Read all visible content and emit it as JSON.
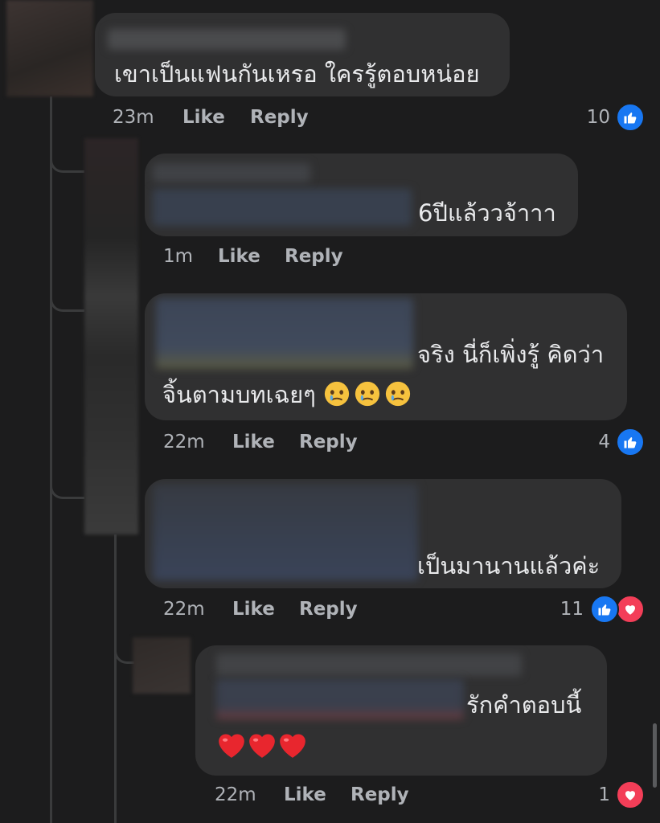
{
  "colors": {
    "background": "#1c1c1d",
    "bubble": "#303031",
    "like_blue": "#1877f2",
    "love_red": "#f33e58",
    "meta_text": "#b0b3b8"
  },
  "comments": [
    {
      "text_lines": [
        "เขาเป็นแฟนกันเหรอ ใครรู้ตอบหน่อย"
      ],
      "time": "23m",
      "like_label": "Like",
      "reply_label": "Reply",
      "reaction_count": "10",
      "reactions": [
        "like-icon"
      ]
    },
    {
      "text_lines": [
        "6ปีแล้ววจ้าาา"
      ],
      "time": "1m",
      "like_label": "Like",
      "reply_label": "Reply",
      "reaction_count": "",
      "reactions": []
    },
    {
      "text_lines": [
        "จริง นี่ก็เพิ่งรู้ คิดว่า",
        "จิ้นตามบทเฉยๆ"
      ],
      "emojis": [
        "face-holding-back-tears-icon",
        "face-holding-back-tears-icon",
        "face-holding-back-tears-icon"
      ],
      "time": "22m",
      "like_label": "Like",
      "reply_label": "Reply",
      "reaction_count": "4",
      "reactions": [
        "like-icon"
      ]
    },
    {
      "text_lines": [
        "เป็นมานานแล้วค่ะ"
      ],
      "time": "22m",
      "like_label": "Like",
      "reply_label": "Reply",
      "reaction_count": "11",
      "reactions": [
        "like-icon",
        "heart-icon"
      ]
    },
    {
      "text_lines": [
        "รักคำตอบนี้"
      ],
      "emojis": [
        "red-heart-icon",
        "red-heart-icon",
        "red-heart-icon"
      ],
      "time": "22m",
      "like_label": "Like",
      "reply_label": "Reply",
      "reaction_count": "1",
      "reactions": [
        "heart-icon"
      ]
    }
  ]
}
